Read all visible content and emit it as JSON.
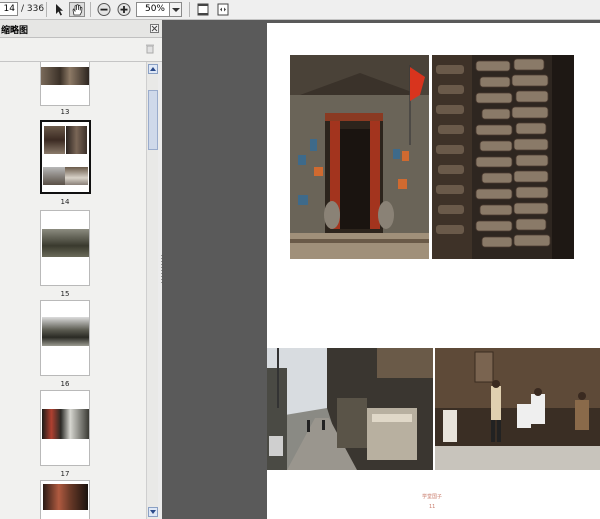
{
  "toolbar": {
    "current_page": "14",
    "page_total": "/ 336",
    "zoom": "50%",
    "icons": [
      "select-arrow-icon",
      "hand-tool-icon",
      "zoom-out-icon",
      "zoom-in-icon",
      "fit-page-icon",
      "fit-width-icon"
    ]
  },
  "pane": {
    "title": "缩略图",
    "thumbnails": [
      {
        "label": "13",
        "selected": false
      },
      {
        "label": "14",
        "selected": true
      },
      {
        "label": "15",
        "selected": false
      },
      {
        "label": "16",
        "selected": false
      },
      {
        "label": "17",
        "selected": false
      },
      {
        "label": "",
        "selected": false
      }
    ]
  },
  "document": {
    "caption_line1": "学堂国子",
    "caption_line2": "11"
  },
  "colors": {
    "doc_background": "#5a5a5a",
    "selected_thumb_border": "#111111",
    "caption_color": "#c87a6a"
  }
}
